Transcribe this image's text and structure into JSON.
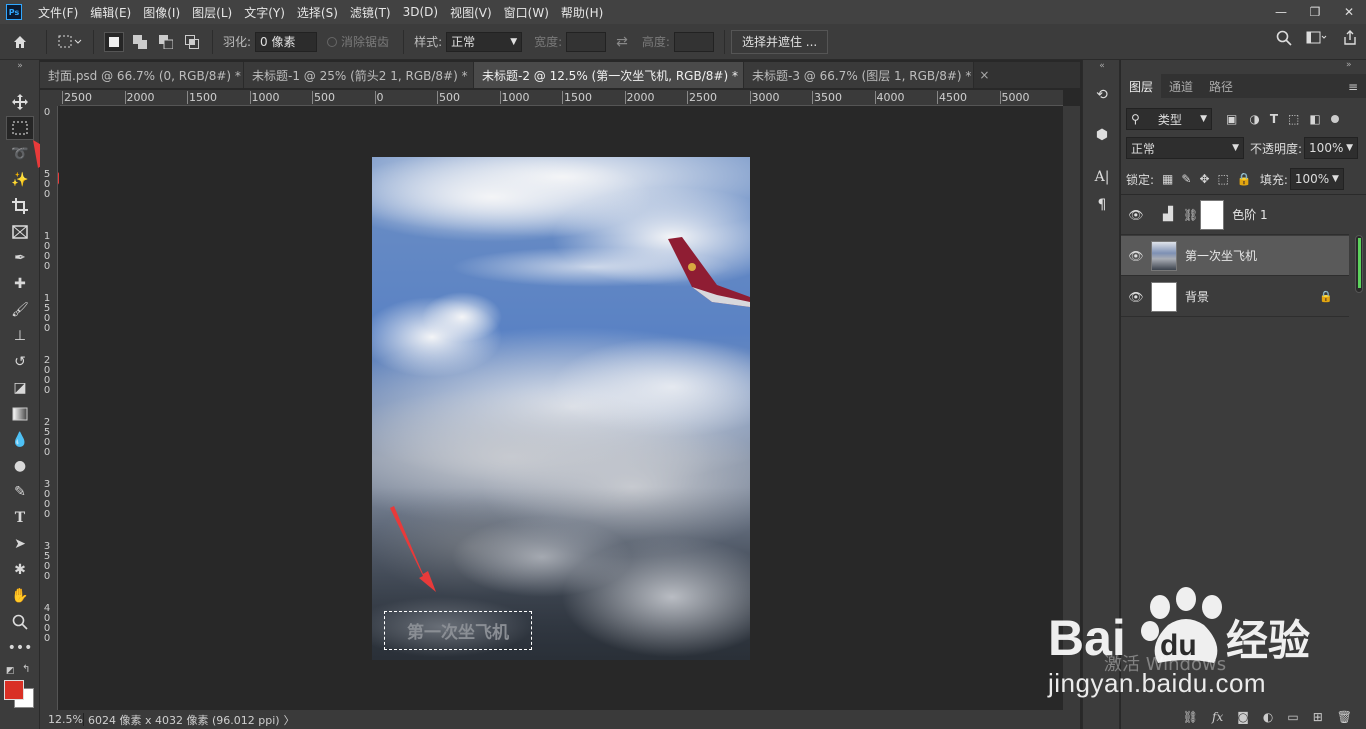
{
  "app": {
    "logo": "Ps"
  },
  "menu": [
    "文件(F)",
    "编辑(E)",
    "图像(I)",
    "图层(L)",
    "文字(Y)",
    "选择(S)",
    "滤镜(T)",
    "3D(D)",
    "视图(V)",
    "窗口(W)",
    "帮助(H)"
  ],
  "window_controls": {
    "minimize": "—",
    "restore": "❐",
    "close": "✕"
  },
  "options": {
    "feather_label": "羽化:",
    "feather_value": "0 像素",
    "antialias_label": "消除锯齿",
    "style_label": "样式:",
    "style_value": "正常",
    "width_label": "宽度:",
    "height_label": "高度:",
    "select_mask_button": "选择并遮住 ..."
  },
  "tabs": [
    {
      "label": "封面.psd @ 66.7% (0, RGB/8#) *",
      "close": "×"
    },
    {
      "label": "未标题-1 @ 25% (箭头2 1, RGB/8#) *",
      "close": "×"
    },
    {
      "label": "未标题-2 @ 12.5% (第一次坐飞机, RGB/8#) *",
      "close": "×"
    },
    {
      "label": "未标题-3 @ 66.7% (图层 1, RGB/8#) *",
      "close": "×"
    }
  ],
  "ruler": {
    "horizontal": [
      "2500",
      "2000",
      "1500",
      "1000",
      "500",
      "0",
      "500",
      "1000",
      "1500",
      "2000",
      "2500",
      "3000",
      "3500",
      "4000",
      "4500",
      "5000"
    ],
    "vertical": [
      "0",
      "500",
      "1000",
      "1500",
      "2000",
      "2500",
      "3000",
      "3500",
      "4000"
    ]
  },
  "canvas": {
    "selection_text": "第一次坐飞机"
  },
  "status": {
    "zoom": "12.5%",
    "doc_info": "6024 像素 x 4032 像素 (96.012 ppi)",
    "arrow": "〉"
  },
  "layers_panel": {
    "tabs": [
      "图层",
      "通道",
      "路径"
    ],
    "filter_label": "类型",
    "blend_mode": "正常",
    "opacity_label": "不透明度:",
    "opacity_value": "100%",
    "lock_label": "锁定:",
    "fill_label": "填充:",
    "fill_value": "100%",
    "layers": [
      {
        "name": "色阶 1",
        "type": "adjustment"
      },
      {
        "name": "第一次坐飞机",
        "type": "image",
        "selected": true
      },
      {
        "name": "背景",
        "type": "background",
        "locked": true
      }
    ]
  },
  "watermark": {
    "windows": "激活 Windows",
    "baidu_brand": "Bai",
    "baidu_du": "du",
    "baidu_jingyan": "经验",
    "baidu_url": "jingyan.baidu.com"
  },
  "colors": {
    "foreground": "#d93025",
    "background": "#ffffff",
    "accent_arrow": "#e83a3a"
  }
}
